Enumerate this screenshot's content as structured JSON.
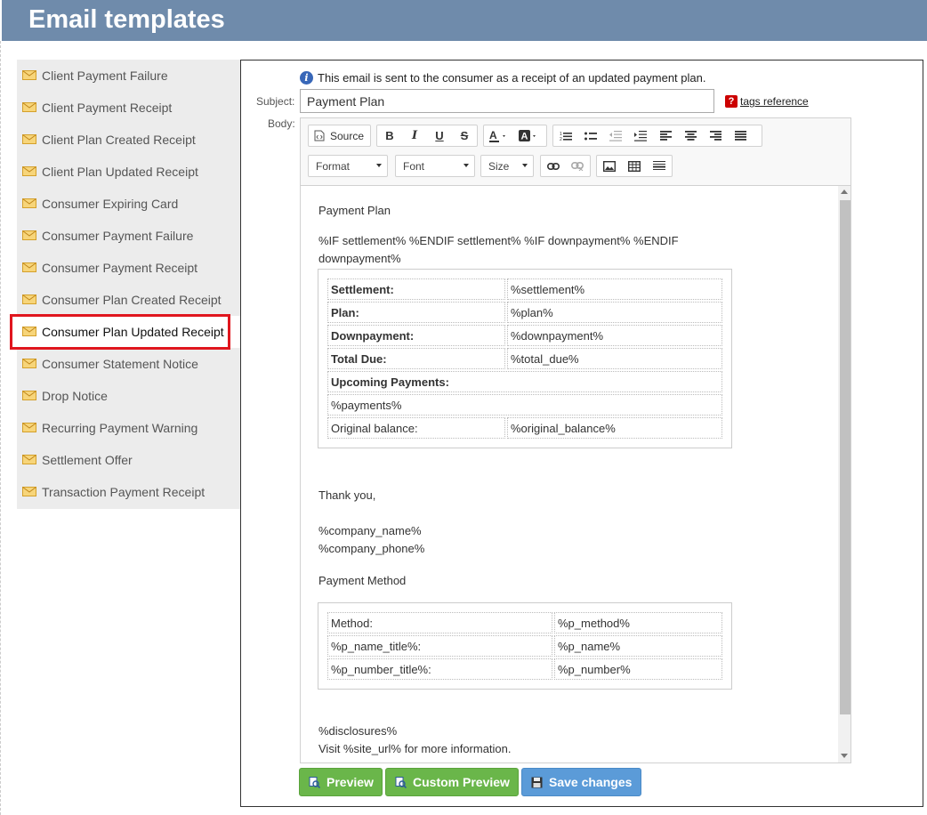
{
  "header": {
    "title": "Email templates"
  },
  "sidebar": {
    "items": [
      {
        "label": "Client Payment Failure"
      },
      {
        "label": "Client Payment Receipt"
      },
      {
        "label": "Client Plan Created Receipt"
      },
      {
        "label": "Client Plan Updated Receipt"
      },
      {
        "label": "Consumer Expiring Card"
      },
      {
        "label": "Consumer Payment Failure"
      },
      {
        "label": "Consumer Payment Receipt"
      },
      {
        "label": "Consumer Plan Created Receipt"
      },
      {
        "label": "Consumer Plan Updated Receipt"
      },
      {
        "label": "Consumer Statement Notice"
      },
      {
        "label": "Drop Notice"
      },
      {
        "label": "Recurring Payment Warning"
      },
      {
        "label": "Settlement Offer"
      },
      {
        "label": "Transaction Payment Receipt"
      }
    ],
    "selected": "Consumer Plan Updated Receipt"
  },
  "form": {
    "info": "This email is sent to the consumer as a receipt of an updated payment plan.",
    "subject_label": "Subject:",
    "subject_value": "Payment Plan",
    "tags_reference": "tags reference",
    "body_label": "Body:"
  },
  "toolbar": {
    "source_label": "Source",
    "bold": "B",
    "italic": "I",
    "underline": "U",
    "strike": "S",
    "format_label": "Format",
    "font_label": "Font",
    "size_label": "Size"
  },
  "body": {
    "heading": "Payment Plan",
    "line1": "%IF settlement% %ENDIF settlement% %IF downpayment% %ENDIF",
    "line2": "downpayment%",
    "table1": [
      {
        "label": "Settlement:",
        "value": "%settlement%",
        "bold": true
      },
      {
        "label": "Plan:",
        "value": "%plan%",
        "bold": true
      },
      {
        "label": "Downpayment:",
        "value": "%downpayment%",
        "bold": true
      },
      {
        "label": "Total Due:",
        "value": "%total_due%",
        "bold": true
      }
    ],
    "upcoming_label": "Upcoming Payments:",
    "payments_tag": "%payments%",
    "original_balance_label": "Original balance:",
    "original_balance_value": "%original_balance%",
    "thank_you": "Thank you,",
    "company_name": "%company_name%",
    "company_phone": "%company_phone%",
    "payment_method_heading": "Payment Method",
    "table2": [
      {
        "label": "Method:",
        "value": "%p_method%"
      },
      {
        "label": "%p_name_title%:",
        "value": "%p_name%"
      },
      {
        "label": "%p_number_title%:",
        "value": "%p_number%"
      }
    ],
    "disclosures": "%disclosures%",
    "visit_line": "Visit %site_url% for more information."
  },
  "buttons": {
    "preview": "Preview",
    "custom_preview": "Custom Preview",
    "save": "Save changes"
  },
  "colors": {
    "header_bg": "#6f8bab",
    "highlight": "#e0161e",
    "green_button": "#6ab64a",
    "blue_button": "#5b9bd8"
  }
}
